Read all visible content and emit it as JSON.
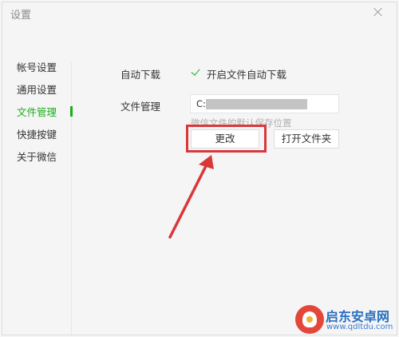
{
  "window": {
    "title": "设置"
  },
  "sidebar": {
    "items": [
      {
        "label": "帐号设置"
      },
      {
        "label": "通用设置"
      },
      {
        "label": "文件管理"
      },
      {
        "label": "快捷按键"
      },
      {
        "label": "关于微信"
      }
    ],
    "active_index": 2
  },
  "settings": {
    "auto_download": {
      "label": "自动下载",
      "checkbox_label": "开启文件自动下载",
      "checked": true
    },
    "file_management": {
      "label": "文件管理",
      "path_value": "C:\\",
      "hint": "微信文件的默认保存位置",
      "change_button": "更改",
      "open_folder_button": "打开文件夹"
    }
  },
  "watermark": {
    "name": "启东安卓网",
    "url": "www.qdltdu.com"
  },
  "colors": {
    "accent": "#1aad19",
    "highlight": "#d9373a",
    "hint": "#b0b0b0"
  }
}
